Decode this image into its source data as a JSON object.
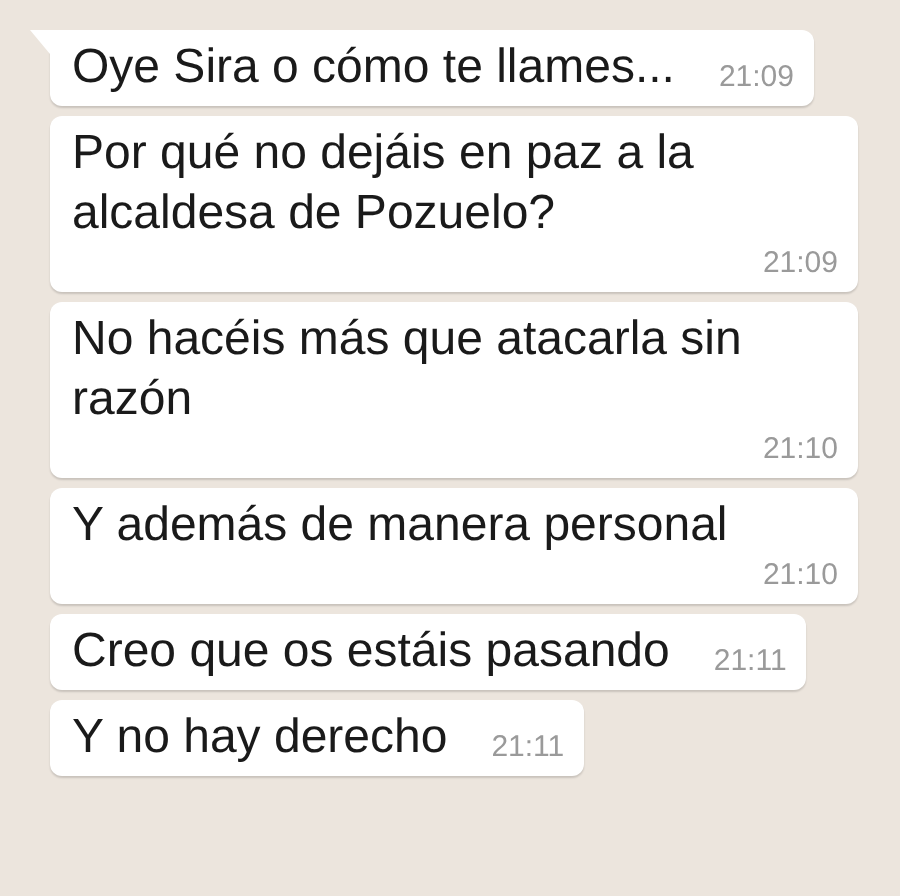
{
  "messages": [
    {
      "text": "Oye Sira o cómo te llames...",
      "time": "21:09"
    },
    {
      "text": "Por qué no dejáis en paz a la alcaldesa de Pozuelo?",
      "time": "21:09"
    },
    {
      "text": "No hacéis más que atacarla sin razón",
      "time": "21:10"
    },
    {
      "text": "Y además de manera personal",
      "time": "21:10"
    },
    {
      "text": "Creo que os estáis pasando",
      "time": "21:11"
    },
    {
      "text": "Y no hay derecho",
      "time": "21:11"
    }
  ]
}
